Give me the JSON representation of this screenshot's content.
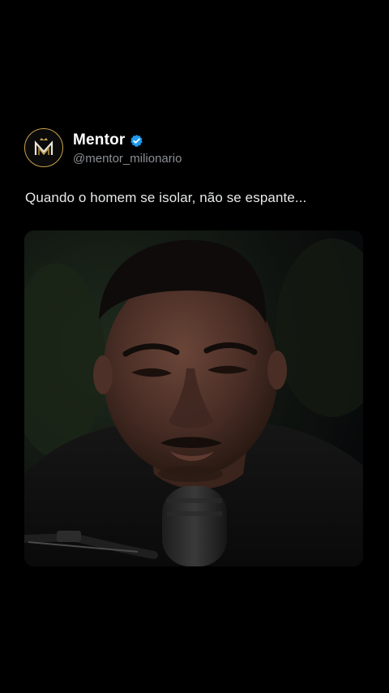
{
  "post": {
    "display_name": "Mentor",
    "handle": "@mentor_milionario",
    "text": "Quando o homem se isolar, não se espante...",
    "verified": true,
    "avatar_icon": "mentor-crown-monogram-icon",
    "verified_icon": "verified-badge-icon",
    "media_type": "video-frame"
  },
  "colors": {
    "background": "#000000",
    "handle": "#8b8f94",
    "text": "#e7e9ea",
    "verified_blue": "#1d9bf0",
    "avatar_gold": "#c8a04a"
  }
}
